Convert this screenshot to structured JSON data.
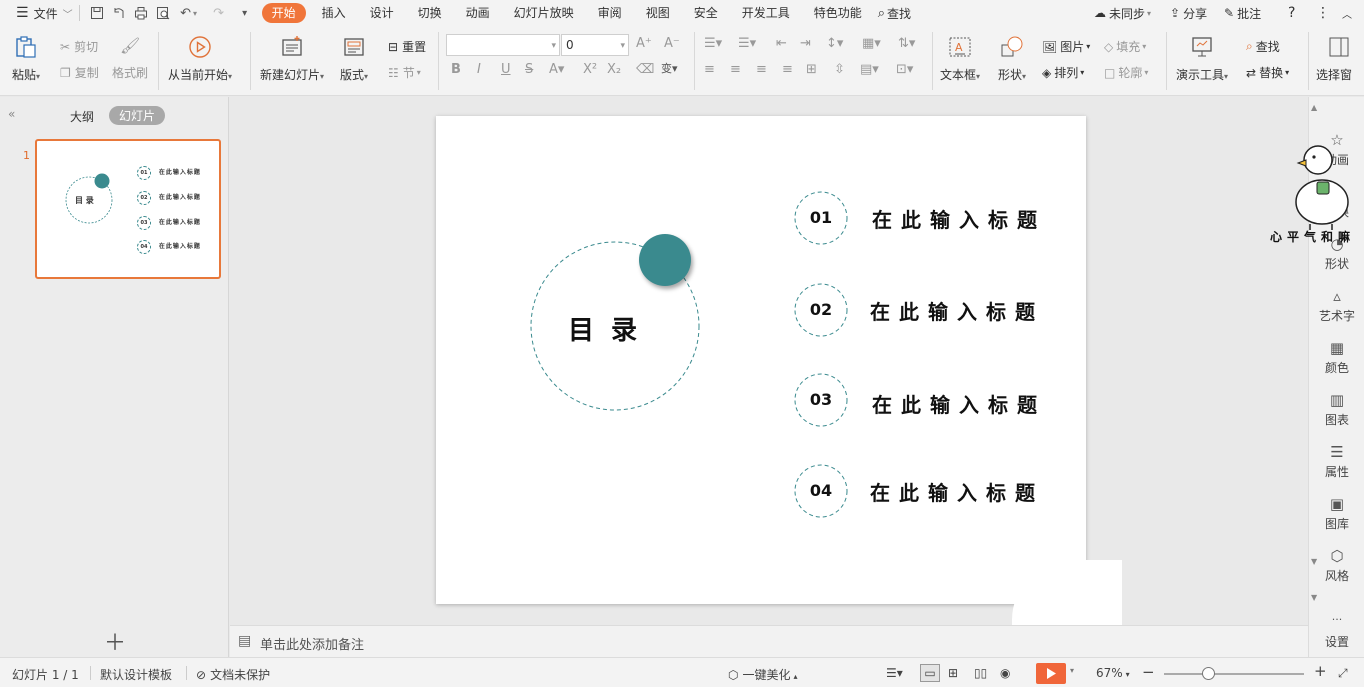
{
  "menubar": {
    "file_menu": "文件",
    "tabs": [
      "开始",
      "插入",
      "设计",
      "切换",
      "动画",
      "幻灯片放映",
      "审阅",
      "视图",
      "安全",
      "开发工具",
      "特色功能"
    ],
    "search": "查找",
    "sync": "未同步",
    "share": "分享",
    "comment": "批注"
  },
  "ribbon": {
    "paste": "粘贴",
    "cut": "剪切",
    "copy": "复制",
    "format_painter": "格式刷",
    "play_from_current": "从当前开始",
    "new_slide": "新建幻灯片",
    "layout": "版式",
    "reset": "重置",
    "section": "节",
    "font_size_value": "0",
    "textbox": "文本框",
    "shape": "形状",
    "picture": "图片",
    "fill": "填充",
    "arrange": "排列",
    "outline": "轮廓",
    "present_tools": "演示工具",
    "find": "查找",
    "replace": "替换",
    "select_pane": "选择窗"
  },
  "left_pane": {
    "outline_tab": "大纲",
    "slides_tab": "幻灯片",
    "slide_number": "1"
  },
  "slide": {
    "toc_title": "目 录",
    "items": [
      {
        "num": "01",
        "title": "在此输入标题"
      },
      {
        "num": "02",
        "title": "在此输入标题"
      },
      {
        "num": "03",
        "title": "在此输入标题"
      },
      {
        "num": "04",
        "title": "在此输入标题"
      }
    ],
    "accent_color": "#3a8a8e",
    "dashed_color": "#3a8a8e"
  },
  "notes": {
    "placeholder": "单击此处添加备注"
  },
  "sticker": {
    "caption": "心平气和嘛"
  },
  "right_sidebar": {
    "items": [
      "动画",
      "切换",
      "形状",
      "艺术字",
      "颜色",
      "图表",
      "属性",
      "图库",
      "风格",
      "设置"
    ]
  },
  "statusbar": {
    "slide_info": "幻灯片 1 / 1",
    "template": "默认设计模板",
    "protect": "文档未保护",
    "beautify": "一键美化",
    "zoom": "67%"
  }
}
